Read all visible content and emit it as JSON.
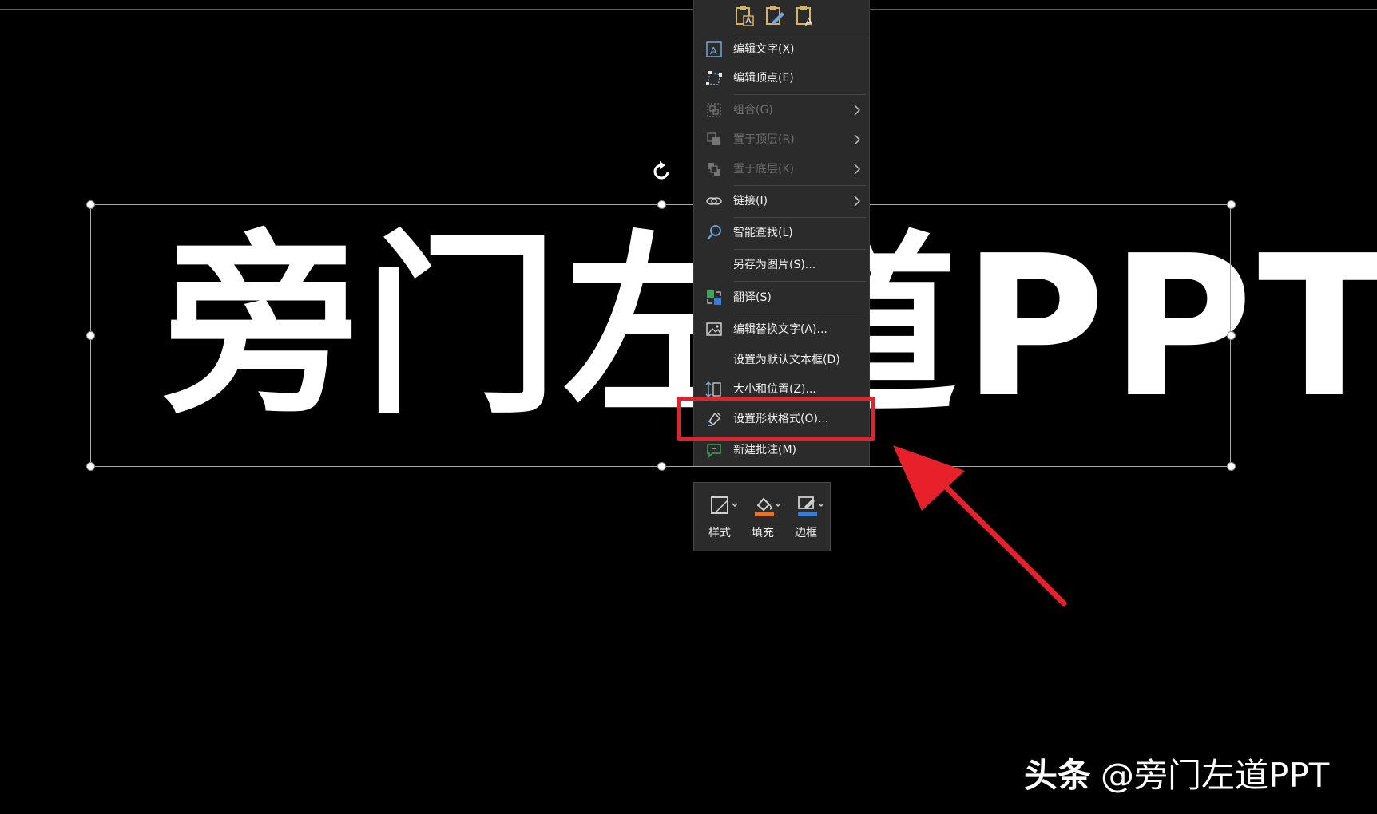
{
  "slide": {
    "headline": "旁门左道PPT"
  },
  "context_menu": {
    "paste_options": [
      "paste-keep-source-icon",
      "paste-picture-icon",
      "paste-text-only-icon"
    ],
    "items": [
      {
        "label": "编辑文字(X)",
        "icon": "edit-text-icon",
        "enabled": true,
        "submenu": false
      },
      {
        "label": "编辑顶点(E)",
        "icon": "edit-points-icon",
        "enabled": true,
        "submenu": false
      },
      {
        "label": "组合(G)",
        "icon": "group-icon",
        "enabled": false,
        "submenu": true
      },
      {
        "label": "置于顶层(R)",
        "icon": "bring-to-front-icon",
        "enabled": false,
        "submenu": true
      },
      {
        "label": "置于底层(K)",
        "icon": "send-to-back-icon",
        "enabled": false,
        "submenu": true
      },
      {
        "label": "链接(I)",
        "icon": "link-icon",
        "enabled": true,
        "submenu": true
      },
      {
        "label": "智能查找(L)",
        "icon": "smart-lookup-icon",
        "enabled": true,
        "submenu": false
      },
      {
        "label": "另存为图片(S)...",
        "icon": "",
        "enabled": true,
        "submenu": false
      },
      {
        "label": "翻译(S)",
        "icon": "translate-icon",
        "enabled": true,
        "submenu": false
      },
      {
        "label": "编辑替换文字(A)...",
        "icon": "alt-text-icon",
        "enabled": true,
        "submenu": false
      },
      {
        "label": "设置为默认文本框(D)",
        "icon": "",
        "enabled": true,
        "submenu": false
      },
      {
        "label": "大小和位置(Z)...",
        "icon": "size-position-icon",
        "enabled": true,
        "submenu": false
      },
      {
        "label": "设置形状格式(O)...",
        "icon": "format-shape-icon",
        "enabled": true,
        "submenu": false
      },
      {
        "label": "新建批注(M)",
        "icon": "new-comment-icon",
        "enabled": true,
        "submenu": false
      }
    ]
  },
  "mini_toolbar": {
    "style_label": "样式",
    "fill_label": "填充",
    "outline_label": "边框"
  },
  "watermark": {
    "brand": "头条",
    "handle": "@旁门左道PPT"
  },
  "colors": {
    "background": "#000000",
    "menu_bg": "#2b2b2b",
    "highlight": "#e8202a",
    "fill_accent": "#e8742a",
    "outline_accent": "#3a7bd5"
  }
}
